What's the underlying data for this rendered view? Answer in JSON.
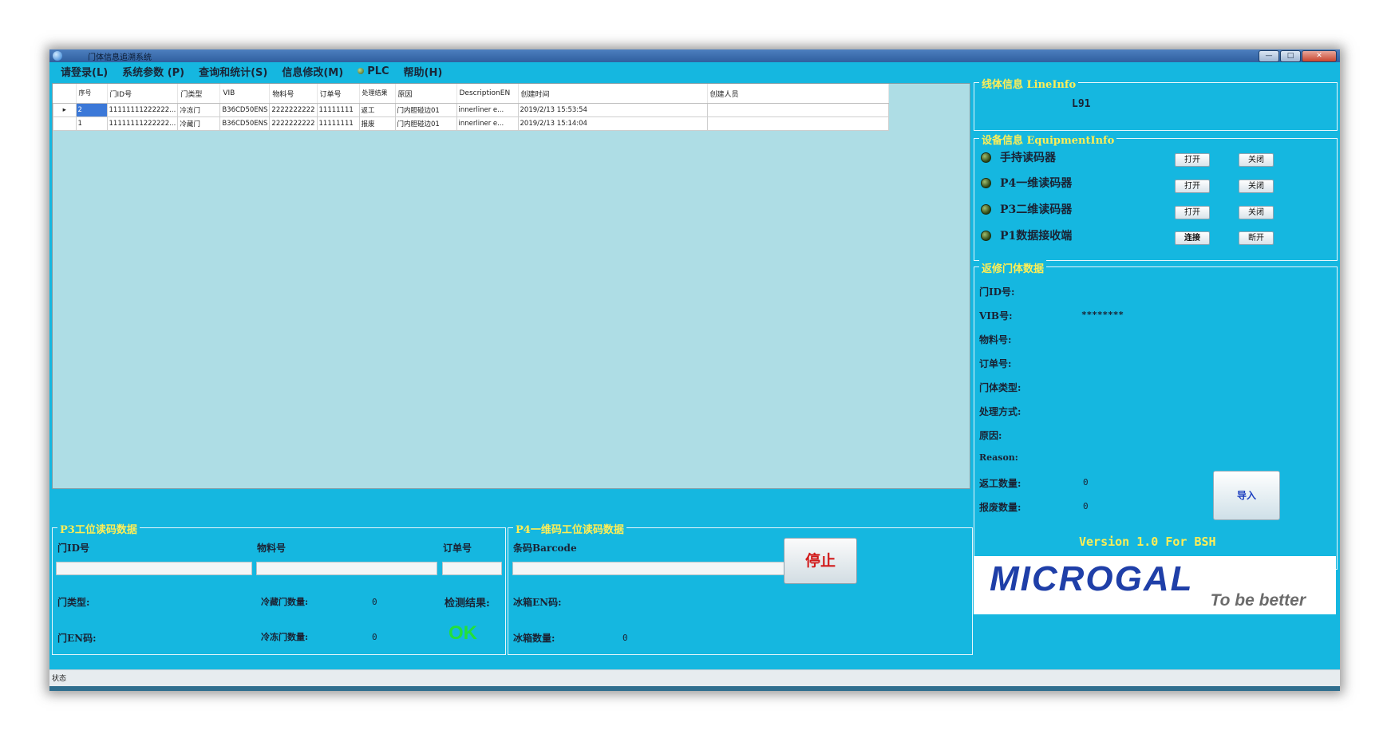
{
  "window": {
    "title": "门体信息追溯系统",
    "controls": [
      "—",
      "□",
      "✕"
    ]
  },
  "menu": {
    "items": [
      "请登录(L)",
      "系统参数 (P)",
      "查询和统计(S)",
      "信息修改(M)"
    ],
    "plc_label": "PLC",
    "help": "帮助(H)"
  },
  "grid": {
    "columns": [
      "序号",
      "门ID号",
      "门类型",
      "VIB",
      "物料号",
      "订单号",
      "处理结果",
      "原因",
      "DescriptionEN",
      "创建时间",
      "创建人员"
    ],
    "rows": [
      [
        "2",
        "11111111222222...",
        "冷冻门",
        "B36CD50ENS",
        "2222222222",
        "11111111",
        "返工",
        "门内胆碰边01",
        "innerliner e...",
        "2019/2/13 15:53:54",
        ""
      ],
      [
        "1",
        "11111111222222...",
        "冷藏门",
        "B36CD50ENS",
        "2222222222",
        "11111111",
        "报废",
        "门内胆碰边01",
        "innerliner e...",
        "2019/2/13 15:14:04",
        ""
      ]
    ]
  },
  "p3": {
    "title": "P3工位读码数据",
    "door_id_label": "门ID号",
    "material_label": "物料号",
    "order_label": "订单号",
    "door_type_label": "门类型:",
    "fridge_door_count_label": "冷藏门数量:",
    "fridge_door_count": "0",
    "check_result_label": "检测结果:",
    "door_en_label": "门EN码:",
    "freezer_door_count_label": "冷冻门数量:",
    "freezer_door_count": "0",
    "check_result": "OK"
  },
  "p4": {
    "title": "P4一维码工位读码数据",
    "barcode_label": "条码Barcode",
    "fridge_en_label": "冰箱EN码:",
    "fridge_count_label": "冰箱数量:",
    "fridge_count": "0"
  },
  "stop_button": "停止",
  "line_info": {
    "title": "线体信息 LineInfo",
    "value": "L91"
  },
  "equipment": {
    "title": "设备信息 EquipmentInfo",
    "devices": [
      {
        "name": "手持读码器",
        "open": "打开",
        "close": "关闭"
      },
      {
        "name": "P4一维读码器",
        "open": "打开",
        "close": "关闭"
      },
      {
        "name": "P3二维读码器",
        "open": "打开",
        "close": "关闭"
      },
      {
        "name": "P1数据接收端",
        "open": "连接",
        "close": "断开"
      }
    ]
  },
  "repair": {
    "title": "返修门体数据",
    "door_id_label": "门ID号:",
    "vib_label": "VIB号:",
    "vib_value": "********",
    "material_label": "物料号:",
    "order_label": "订单号:",
    "door_type_label": "门体类型:",
    "handling_label": "处理方式:",
    "reason_label": "原因:",
    "reason_en_label": "Reason:",
    "rework_label": "返工数量:",
    "rework_value": "0",
    "scrap_label": "报废数量:",
    "scrap_value": "0",
    "import_button": "导入"
  },
  "version": "Version 1.0 For BSH",
  "logo": {
    "brand": "MICROGAL",
    "slogan": "To be better"
  },
  "status": {
    "label": "状态"
  },
  "colors": {
    "background": "#15b7e0",
    "panel_title": "#ffee55",
    "ok": "#22e03a",
    "stop": "#d11a1a",
    "logo": "#1f3fa8"
  }
}
